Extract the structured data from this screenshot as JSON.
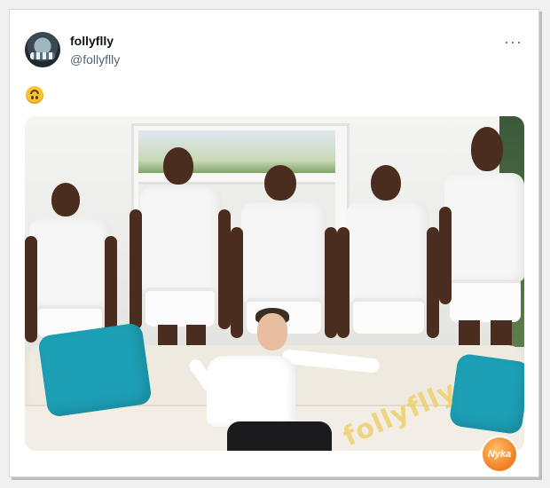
{
  "post": {
    "display_name": "follyflly",
    "handle": "@follyflly",
    "more_label": "···",
    "text_emoji": "upside-down-face"
  },
  "media": {
    "watermark_text": "follyflly",
    "badge_text": "Nyka",
    "accent_colors": {
      "pillow": "#1d9fb5",
      "badge": "#f17d20",
      "watermark": "#ecce62"
    }
  }
}
